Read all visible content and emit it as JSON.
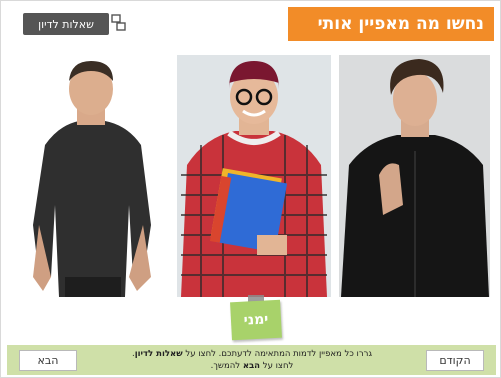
{
  "title": "נחשו מה מאפיין אותי",
  "discussion_button_label": "שאלות לדיון",
  "sticky_note_label": "ימני",
  "instructions": {
    "line1_part1": "גררו כל מאפיין לדמות המתאימה לדעתכם. לחצו על ",
    "line1_bold": "שאלות לדיון",
    "line1_end": ".",
    "line2_part1": "לחצו על ",
    "line2_bold": "הבא",
    "line2_part2": " להמשך."
  },
  "nav": {
    "next_label": "הבא",
    "prev_label": "הקודם"
  },
  "colors": {
    "title_bg": "#f28c28",
    "bottom_bar": "#cfe0a8",
    "note": "#a8d26a",
    "disc_btn": "#555555"
  },
  "icons": {
    "discussion": "discussion-icon"
  }
}
